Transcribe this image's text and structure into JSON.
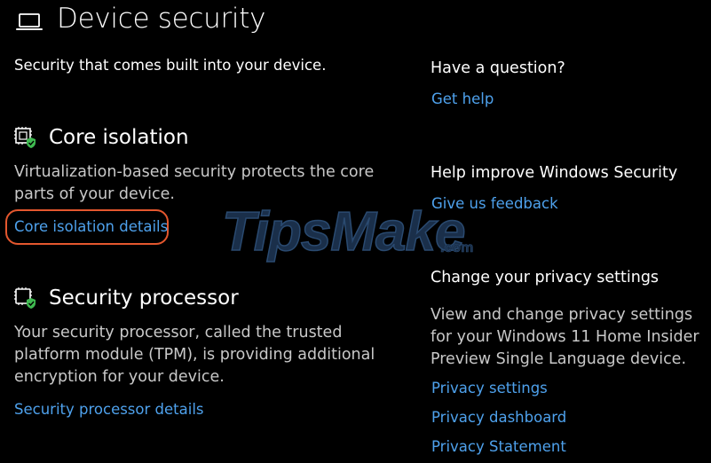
{
  "header": {
    "icon": "laptop-icon",
    "title": "Device security",
    "subtitle": "Security that comes built into your device."
  },
  "core_isolation": {
    "icon": "chip-shield-icon",
    "title": "Core isolation",
    "description": "Virtualization-based security protects the core\nparts of your device.",
    "link_label": "Core isolation details",
    "highlight_color": "#e4572e"
  },
  "security_processor": {
    "icon": "processor-shield-icon",
    "title": "Security processor",
    "description": "Your security processor, called the trusted\nplatform module (TPM), is providing additional\nencryption for your device.",
    "link_label": "Security processor details"
  },
  "sidebar": {
    "question_heading": "Have a question?",
    "get_help_link": "Get help",
    "improve_heading": "Help improve Windows Security",
    "feedback_link": "Give us feedback",
    "privacy_heading": "Change your privacy settings",
    "privacy_description": "View and change privacy settings\nfor your Windows 11 Home Insider\nPreview Single Language device.",
    "privacy_links": [
      "Privacy settings",
      "Privacy dashboard",
      "Privacy Statement"
    ]
  },
  "watermark": {
    "text": "TipsMake",
    "suffix": ".com"
  },
  "colors": {
    "background": "#000000",
    "link": "#4ea1ec",
    "text_secondary": "#c8c8c8",
    "check_green": "#3fb950"
  }
}
